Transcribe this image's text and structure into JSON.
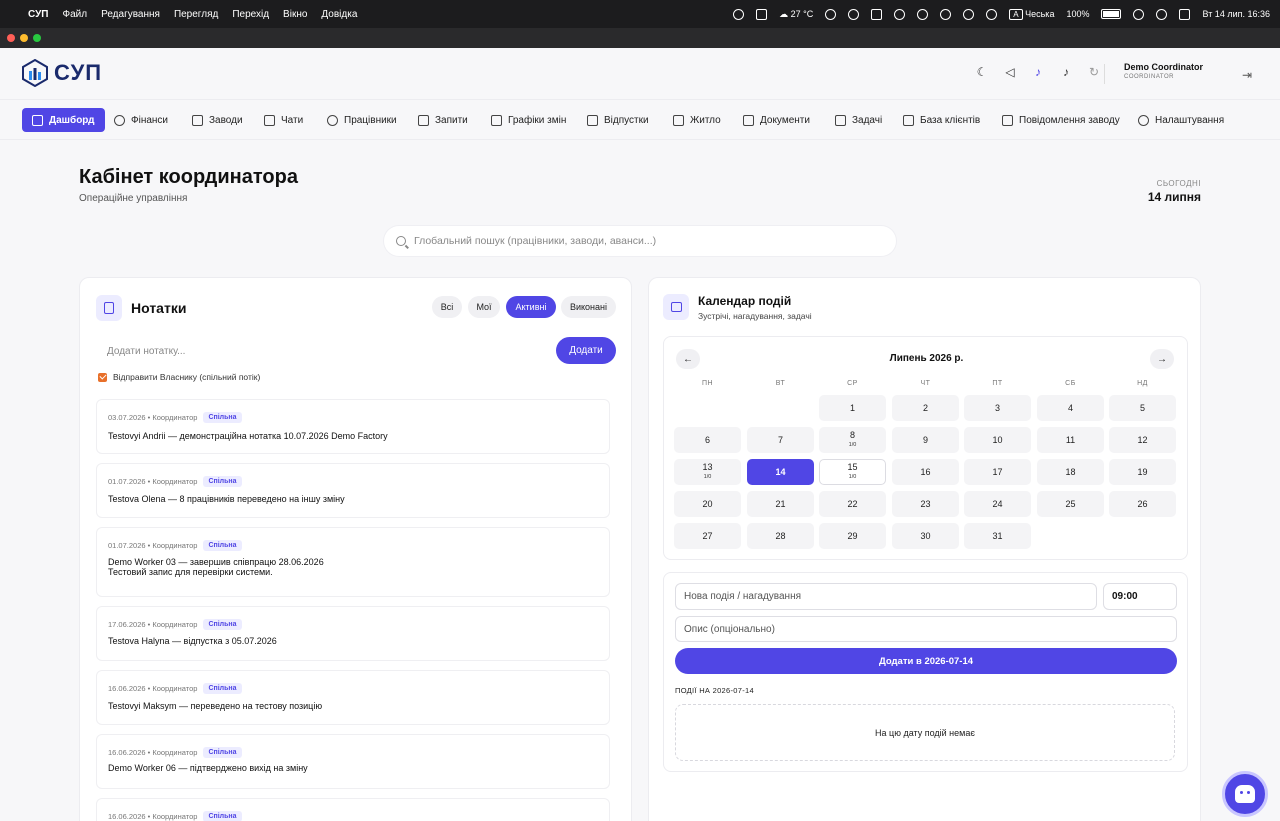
{
  "menubar": {
    "app_name": "СУП",
    "menus": [
      "Файл",
      "Редагування",
      "Перегляд",
      "Перехід",
      "Вікно",
      "Довідка"
    ],
    "weather": "27 °C",
    "keyboard_badge": "A",
    "keyboard_layout": "Чеська",
    "battery": "100%",
    "datetime": "Вт 14 лип.  16:36"
  },
  "header": {
    "logo_text": "СУП",
    "user_name": "Demo Coordinator",
    "user_role": "COORDINATOR"
  },
  "nav": [
    {
      "label": "Дашборд",
      "icon": "home-icon",
      "active": true
    },
    {
      "label": "Фінанси",
      "icon": "dollar-icon"
    },
    {
      "label": "Заводи",
      "icon": "building-icon"
    },
    {
      "label": "Чати",
      "icon": "chat-icon"
    },
    {
      "label": "Працівники",
      "icon": "users-icon"
    },
    {
      "label": "Запити",
      "icon": "message-icon"
    },
    {
      "label": "Графіки змін",
      "icon": "calendar-icon"
    },
    {
      "label": "Відпустки",
      "icon": "calendar-icon"
    },
    {
      "label": "Житло",
      "icon": "home-icon"
    },
    {
      "label": "Документи",
      "icon": "document-icon"
    },
    {
      "label": "Задачі",
      "icon": "clipboard-icon"
    },
    {
      "label": "База клієнтів",
      "icon": "database-icon"
    },
    {
      "label": "Повідомлення заводу",
      "icon": "megaphone-icon"
    },
    {
      "label": "Налаштування",
      "icon": "gear-icon"
    }
  ],
  "page": {
    "title": "Кабінет координатора",
    "subtitle": "Операційне управління",
    "today_label": "СЬОГОДНІ",
    "today_value": "14 липня"
  },
  "search": {
    "placeholder": "Глобальний пошук (працівники, заводи, аванси...)"
  },
  "notes": {
    "title": "Нотатки",
    "filters": [
      "Всі",
      "Мої",
      "Активні",
      "Виконані"
    ],
    "active_filter": "Активні",
    "input_placeholder": "Додати нотатку...",
    "add_label": "Додати",
    "checkbox_label": "Відправити Власнику (спільний потік)",
    "items": [
      {
        "meta": "03.07.2026 • Координатор",
        "tag": "Спільна",
        "text": "Testovyi Andrii — демонстраційна нотатка 10.07.2026 Demo Factory",
        "text2": ""
      },
      {
        "meta": "01.07.2026 • Координатор",
        "tag": "Спільна",
        "text": "Testova Olena — 8 працівників переведено на іншу зміну",
        "text2": ""
      },
      {
        "meta": "01.07.2026 • Координатор",
        "tag": "Спільна",
        "text": "Demo Worker 03 — завершив співпрацю 28.06.2026",
        "text2": "Тестовий запис для перевірки системи."
      },
      {
        "meta": "17.06.2026 • Координатор",
        "tag": "Спільна",
        "text": "Testova Halyna — відпустка з 05.07.2026",
        "text2": ""
      },
      {
        "meta": "16.06.2026 • Координатор",
        "tag": "Спільна",
        "text": "Testovyi Maksym — переведено на тестову позицію",
        "text2": ""
      },
      {
        "meta": "16.06.2026 • Координатор",
        "tag": "Спільна",
        "text": "Demo Worker 06 — підтверджено вихід на зміну",
        "text2": ""
      },
      {
        "meta": "16.06.2026 • Координатор",
        "tag": "Спільна",
        "text": "",
        "text2": ""
      }
    ]
  },
  "calendar": {
    "title": "Календар подій",
    "subtitle": "Зустрічі, нагадування, задачі",
    "month_label": "Липень 2026 р.",
    "prev": "←",
    "next": "→",
    "weekdays": [
      "ПН",
      "ВТ",
      "СР",
      "ЧТ",
      "ПТ",
      "СБ",
      "НД"
    ],
    "days": [
      {
        "d": "1"
      },
      {
        "d": "2"
      },
      {
        "d": "3"
      },
      {
        "d": "4"
      },
      {
        "d": "5"
      },
      {
        "d": "6"
      },
      {
        "d": "7"
      },
      {
        "d": "8",
        "sub": "1/0"
      },
      {
        "d": "9"
      },
      {
        "d": "10"
      },
      {
        "d": "11"
      },
      {
        "d": "12"
      },
      {
        "d": "13",
        "sub": "1/0"
      },
      {
        "d": "14",
        "selected": true
      },
      {
        "d": "15",
        "sub": "1/0"
      },
      {
        "d": "16"
      },
      {
        "d": "17"
      },
      {
        "d": "18"
      },
      {
        "d": "19"
      },
      {
        "d": "20"
      },
      {
        "d": "21"
      },
      {
        "d": "22"
      },
      {
        "d": "23"
      },
      {
        "d": "24"
      },
      {
        "d": "25"
      },
      {
        "d": "26"
      },
      {
        "d": "27"
      },
      {
        "d": "28"
      },
      {
        "d": "29"
      },
      {
        "d": "30"
      },
      {
        "d": "31"
      }
    ],
    "event_placeholder": "Нова подія / нагадування",
    "time_value": "09:00",
    "desc_placeholder": "Опис (опціонально)",
    "add_label": "Додати в 2026-07-14",
    "events_label": "ПОДІЇ НА 2026-07-14",
    "empty_text": "На цю дату подій немає"
  },
  "colors": {
    "accent": "#5046e5",
    "checkbox": "#e8702a"
  }
}
